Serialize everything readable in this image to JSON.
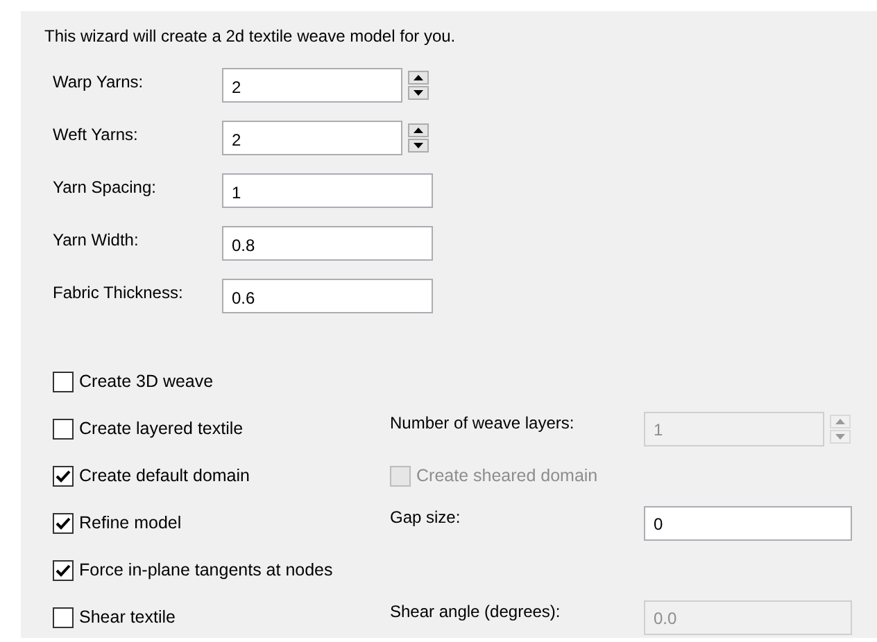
{
  "intro": "This wizard will create a 2d textile weave model for you.",
  "fields": [
    {
      "label": "Warp Yarns:",
      "value": "2",
      "kind": "spin"
    },
    {
      "label": "Weft Yarns:",
      "value": "2",
      "kind": "spin"
    },
    {
      "label": "Yarn Spacing:",
      "value": "1",
      "kind": "text"
    },
    {
      "label": "Yarn Width:",
      "value": "0.8",
      "kind": "text"
    },
    {
      "label": "Fabric Thickness:",
      "value": "0.6",
      "kind": "text"
    }
  ],
  "options": [
    {
      "label": "Create 3D weave",
      "checked": false
    },
    {
      "label": "Create layered textile",
      "checked": false,
      "side": {
        "kind": "spin",
        "label": "Number of weave layers:",
        "value": "1",
        "disabled": true
      }
    },
    {
      "label": "Create default domain",
      "checked": true,
      "side": {
        "kind": "checkbox",
        "label": "Create sheared domain",
        "checked": false,
        "disabled": true
      }
    },
    {
      "label": "Refine model",
      "checked": true,
      "side": {
        "kind": "text",
        "label": "Gap size:",
        "value": "0",
        "disabled": false
      }
    },
    {
      "label": "Force in-plane tangents at nodes",
      "checked": true
    },
    {
      "label": "Shear textile",
      "checked": false,
      "side": {
        "kind": "text",
        "label": "Shear angle (degrees):",
        "value": "0.0",
        "disabled": true
      }
    }
  ]
}
